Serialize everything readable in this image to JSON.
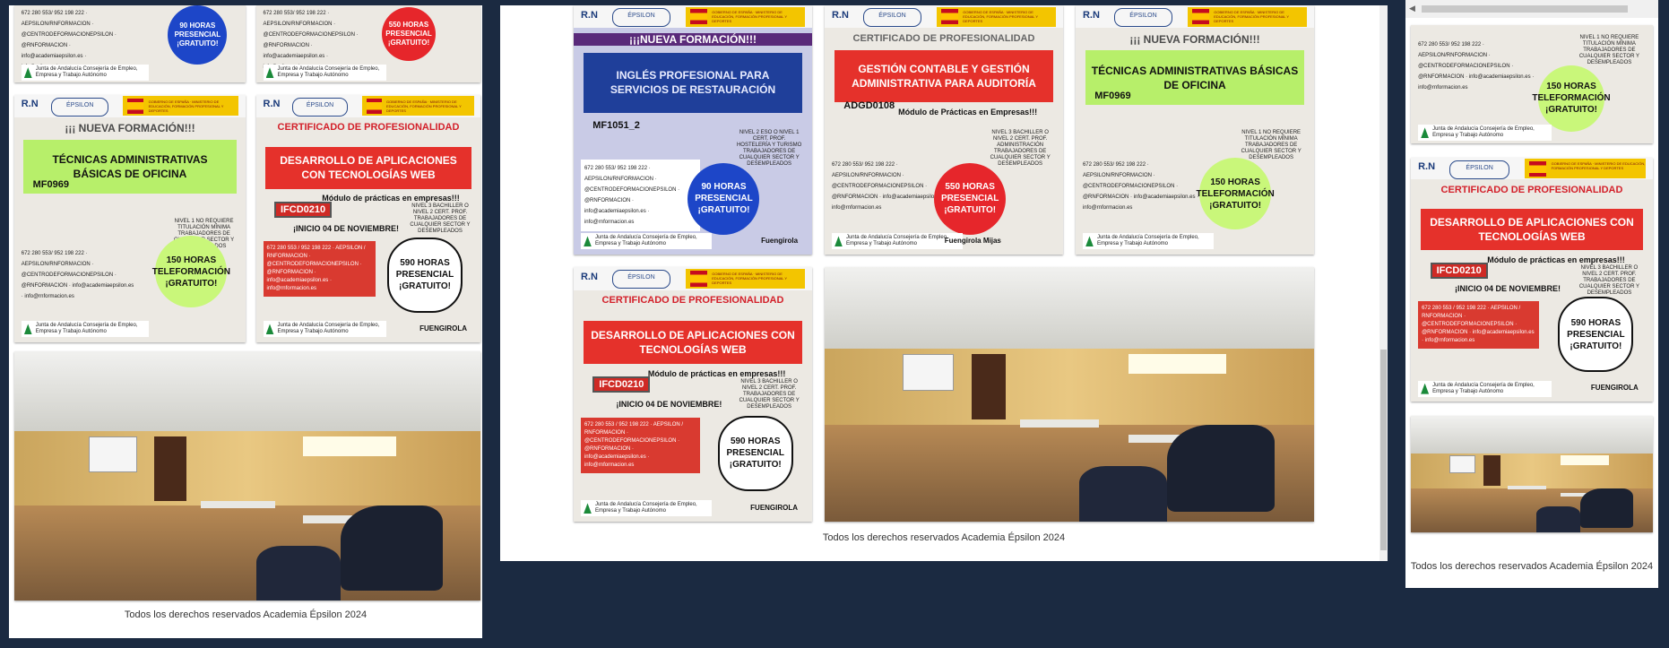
{
  "footer": "Todos los derechos reservados Academia Épsilon 2024",
  "logos": {
    "rn": "R.N",
    "epsilon": "ÉPSILON",
    "gov": "GOBIERNO DE ESPAÑA · MINISTERIO DE EDUCACIÓN, FORMACIÓN PROFESIONAL Y DEPORTES"
  },
  "posters": {
    "tecnicas": {
      "headline": "¡¡¡ NUEVA FORMACIÓN!!!",
      "title": "TÉCNICAS ADMINISTRATIVAS BÁSICAS DE OFICINA",
      "code": "MF0969",
      "notes": "NIVEL 1 NO REQUIERE TITULACIÓN MÍNIMA TRABAJADORES DE CUALQUIER SECTOR Y DESEMPLEADOS",
      "badge": "150 HORAS TELEFORMACIÓN ¡GRATUITO!",
      "contacts": "672 280 553/ 952 198 222 · AEPSILON/RNFORMACION · @CENTRODEFORMACIONEPSILON · @RNFORMACION · info@academiaepsilon.es · info@rnformacion.es",
      "junta": "Junta de Andalucía Consejería de Empleo, Empresa y Trabajo Autónomo"
    },
    "desarrollo": {
      "headline": "CERTIFICADO DE PROFESIONALIDAD",
      "title": "DESARROLLO DE APLICACIONES CON TECNOLOGÍAS WEB",
      "code": "IFCD0210",
      "modulo": "Módulo de prácticas en empresas!!!",
      "inicio": "¡INICIO 04 DE NOVIEMBRE!",
      "notes": "NIVEL 3 BACHILLER O NIVEL 2 CERT. PROF. TRABAJADORES DE CUALQUIER SECTOR Y DESEMPLEADOS",
      "badge": "590 HORAS PRESENCIAL ¡GRATUITO!",
      "contacts": "672 280 553 / 952 198 222 · AEPSILON / RNFORMACION · @CENTRODEFORMACIONEPSILON · @RNFORMACION · info@academiaepsilon.es · info@rnformacion.es",
      "junta": "Junta de Andalucía Consejería de Empleo, Empresa y Trabajo Autónomo",
      "city": "FUENGIROLA"
    },
    "ingles": {
      "headline": "¡¡¡NUEVA FORMACIÓN!!!",
      "title": "INGLÉS PROFESIONAL PARA SERVICIOS DE RESTAURACIÓN",
      "code": "MF1051_2",
      "notes": "NIVEL 2 ESO O NIVEL 1 CERT. PROF. HOSTELERÍA Y TURISMO TRABAJADORES DE CUALQUIER SECTOR Y DESEMPLEADOS",
      "badge": "90 HORAS PRESENCIAL ¡GRATUITO!",
      "contacts": "672 280 553/ 952 198 222 · AEPSILON/RNFORMACION · @CENTRODEFORMACIONEPSILON · @RNFORMACION · info@academiaepsilon.es · info@rnformacion.es",
      "junta": "Junta de Andalucía Consejería de Empleo, Empresa y Trabajo Autónomo",
      "city": "Fuengirola"
    },
    "gestion": {
      "headline": "CERTIFICADO DE PROFESIONALIDAD",
      "title": "GESTIÓN CONTABLE Y GESTIÓN ADMINISTRATIVA PARA AUDITORÍA",
      "code": "ADGD0108",
      "modulo": "Módulo de Prácticas en Empresas!!!",
      "notes": "NIVEL 3 BACHILLER O NIVEL 2 CERT. PROF. ADMINISTRACIÓN TRABAJADORES DE CUALQUIER SECTOR Y DESEMPLEADOS",
      "badge": "550 HORAS PRESENCIAL ¡GRATUITO!",
      "contacts": "672 280 553/ 952 198 222 · AEPSILON/RNFORMACION · @CENTRODEFORMACIONEPSILON · @RNFORMACION · info@academiaepsilon.es · info@rnformacion.es",
      "junta": "Junta de Andalucía Consejería de Empleo, Empresa y Trabajo Autónomo",
      "city": "Fuengirola Mijas"
    }
  }
}
